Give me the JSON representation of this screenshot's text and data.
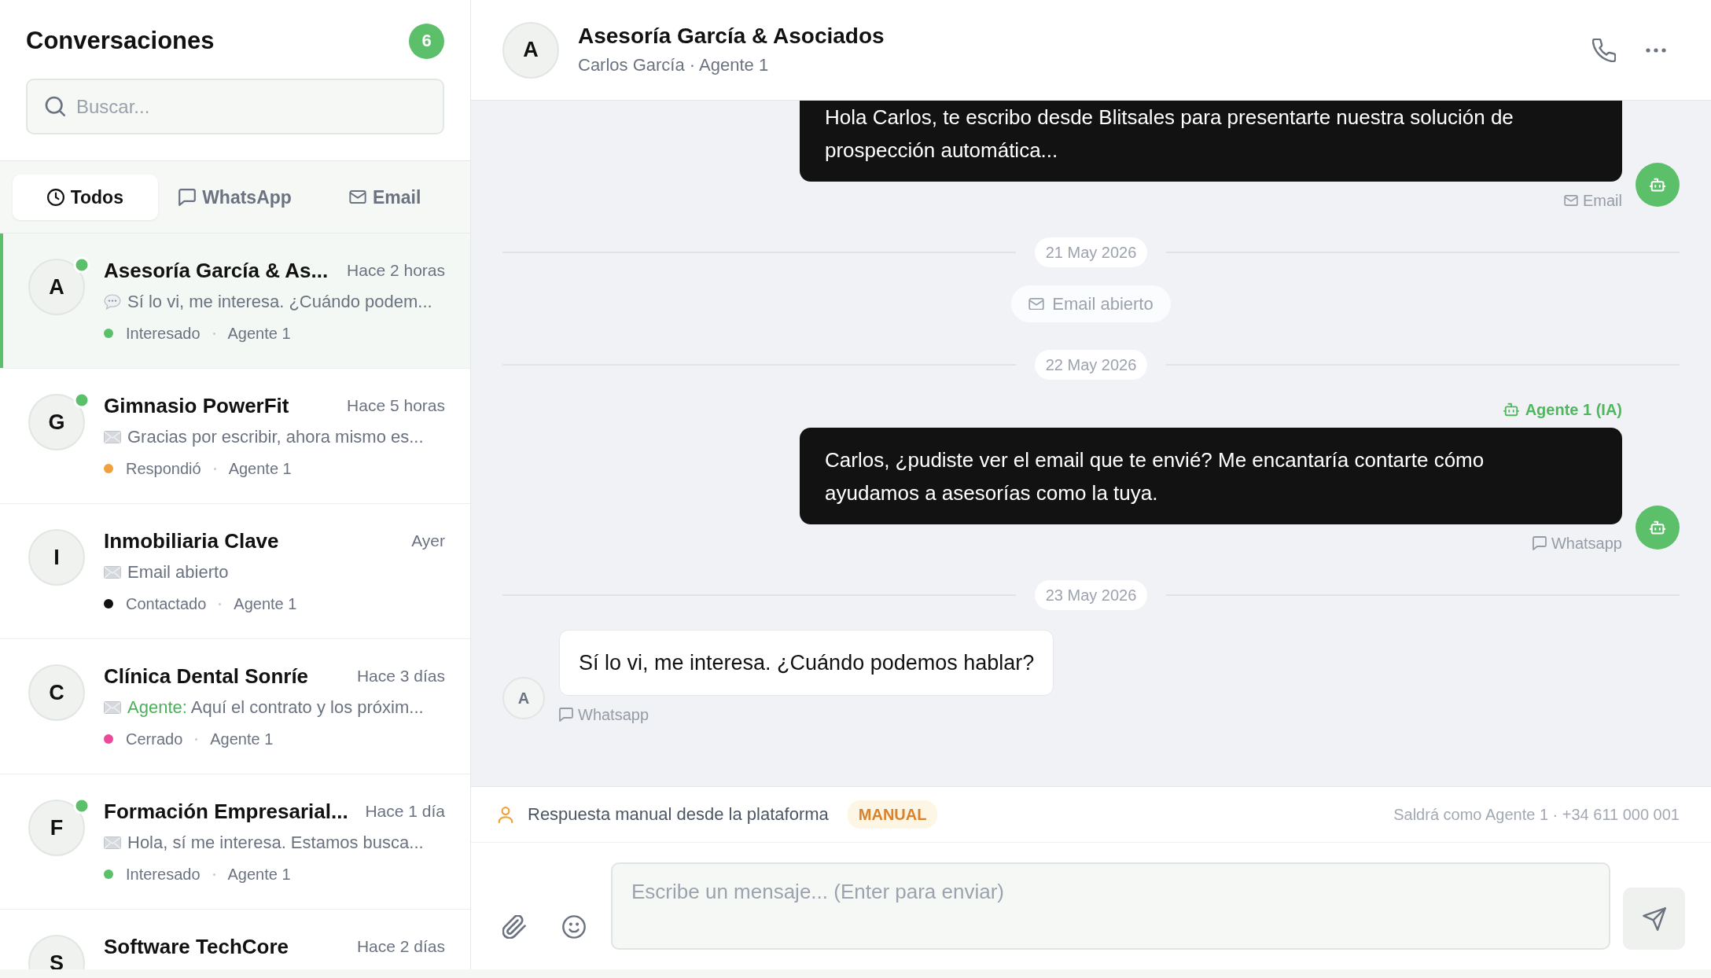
{
  "sidebar": {
    "title": "Conversaciones",
    "count": "6",
    "search": {
      "placeholder": "Buscar..."
    },
    "tabs": [
      {
        "kind": "all",
        "label": "Todos",
        "selected": true
      },
      {
        "kind": "chat",
        "label": "WhatsApp",
        "selected": false
      },
      {
        "kind": "email",
        "label": "Email",
        "selected": false
      }
    ],
    "conversations": [
      {
        "initial": "A",
        "online": true,
        "selected": true,
        "name": "Asesoría García & As...",
        "time": "Hace 2 horas",
        "preview": {
          "kind": "chat",
          "text": "Sí lo vi, me interesa. ¿Cuándo podem..."
        },
        "status": {
          "label": "Interesado",
          "color": "#5cbf6a"
        },
        "agent": "Agente 1"
      },
      {
        "initial": "G",
        "online": true,
        "selected": false,
        "name": "Gimnasio PowerFit",
        "time": "Hace 5 horas",
        "preview": {
          "kind": "email",
          "text": "Gracias por escribir, ahora mismo es..."
        },
        "status": {
          "label": "Respondió",
          "color": "#f0a03c"
        },
        "agent": "Agente 1"
      },
      {
        "initial": "I",
        "online": false,
        "selected": false,
        "name": "Inmobiliaria Clave",
        "time": "Ayer",
        "preview": {
          "kind": "email",
          "text": "Email abierto"
        },
        "status": {
          "label": "Contactado",
          "color": "#111111"
        },
        "agent": "Agente 1"
      },
      {
        "initial": "C",
        "online": false,
        "selected": false,
        "name": "Clínica Dental Sonríe",
        "time": "Hace 3 días",
        "preview": {
          "kind": "email",
          "author": "Agente:",
          "text": "Aquí el contrato y los próxim..."
        },
        "status": {
          "label": "Cerrado",
          "color": "#ec4899"
        },
        "agent": "Agente 1"
      },
      {
        "initial": "F",
        "online": true,
        "selected": false,
        "name": "Formación Empresarial...",
        "time": "Hace 1 día",
        "preview": {
          "kind": "email",
          "text": "Hola, sí me interesa. Estamos busca..."
        },
        "status": {
          "label": "Interesado",
          "color": "#5cbf6a"
        },
        "agent": "Agente 1"
      },
      {
        "initial": "S",
        "online": false,
        "selected": false,
        "name": "Software TechCore",
        "time": "Hace 2 días"
      }
    ]
  },
  "chat": {
    "header": {
      "initial": "A",
      "name": "Asesoría García & Asociados",
      "subtitle": "Carlos García · Agente 1"
    },
    "messages": [
      {
        "kind": "outgoing",
        "text": "Hola Carlos, te escribo desde Blitsales para presentarte nuestra solución de prospección automática...",
        "channel": {
          "kind": "email",
          "label": "Email"
        }
      },
      {
        "kind": "date",
        "text": "21 May 2026"
      },
      {
        "kind": "event",
        "event": {
          "kind": "email",
          "text": "Email abierto"
        }
      },
      {
        "kind": "date",
        "text": "22 May 2026"
      },
      {
        "kind": "outgoing",
        "sender": "Agente 1 (IA)",
        "text": "Carlos, ¿pudiste ver el email que te envié? Me encantaría contarte cómo ayudamos a asesorías como la tuya.",
        "channel": {
          "kind": "chat",
          "label": "Whatsapp"
        }
      },
      {
        "kind": "date",
        "text": "23 May 2026"
      },
      {
        "kind": "incoming",
        "initial": "A",
        "text": "Sí lo vi, me interesa. ¿Cuándo podemos hablar?",
        "channel": {
          "kind": "chat",
          "label": "Whatsapp"
        }
      }
    ]
  },
  "composer": {
    "mode": "Respuesta manual desde la plataforma",
    "badge": "MANUAL",
    "sender_note": "Saldrá como Agente 1 · +34 611 000 001",
    "input": {
      "placeholder": "Escribe un mensaje... (Enter para enviar)"
    }
  }
}
